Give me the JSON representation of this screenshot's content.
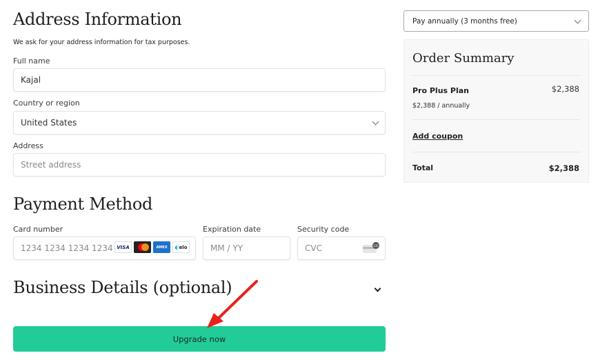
{
  "address": {
    "title": "Address Information",
    "subtitle": "We ask for your address information for tax purposes.",
    "full_name": {
      "label": "Full name",
      "value": "Kajal"
    },
    "country": {
      "label": "Country or region",
      "value": "United States"
    },
    "street": {
      "label": "Address",
      "placeholder": "Street address"
    }
  },
  "payment": {
    "title": "Payment Method",
    "card_number": {
      "label": "Card number",
      "placeholder": "1234 1234 1234 1234"
    },
    "brands": [
      "VISA",
      "Mastercard",
      "AMEX",
      "elo"
    ],
    "expiry": {
      "label": "Expiration date",
      "placeholder": "MM / YY"
    },
    "cvc": {
      "label": "Security code",
      "placeholder": "CVC",
      "icon_text": "135"
    }
  },
  "business": {
    "title": "Business Details (optional)"
  },
  "actions": {
    "upgrade_label": "Upgrade now",
    "upgrade_color": "#22cc99"
  },
  "billing": {
    "selected": "Pay annually (3 months free)"
  },
  "summary": {
    "title": "Order Summary",
    "plan_name": "Pro Plus Plan",
    "plan_price": "$2,388",
    "plan_sub": "$2,388 / annually",
    "coupon_label": "Add coupon",
    "total_label": "Total",
    "total_value": "$2,388"
  },
  "annotation": {
    "arrow_color": "#e8221b"
  }
}
